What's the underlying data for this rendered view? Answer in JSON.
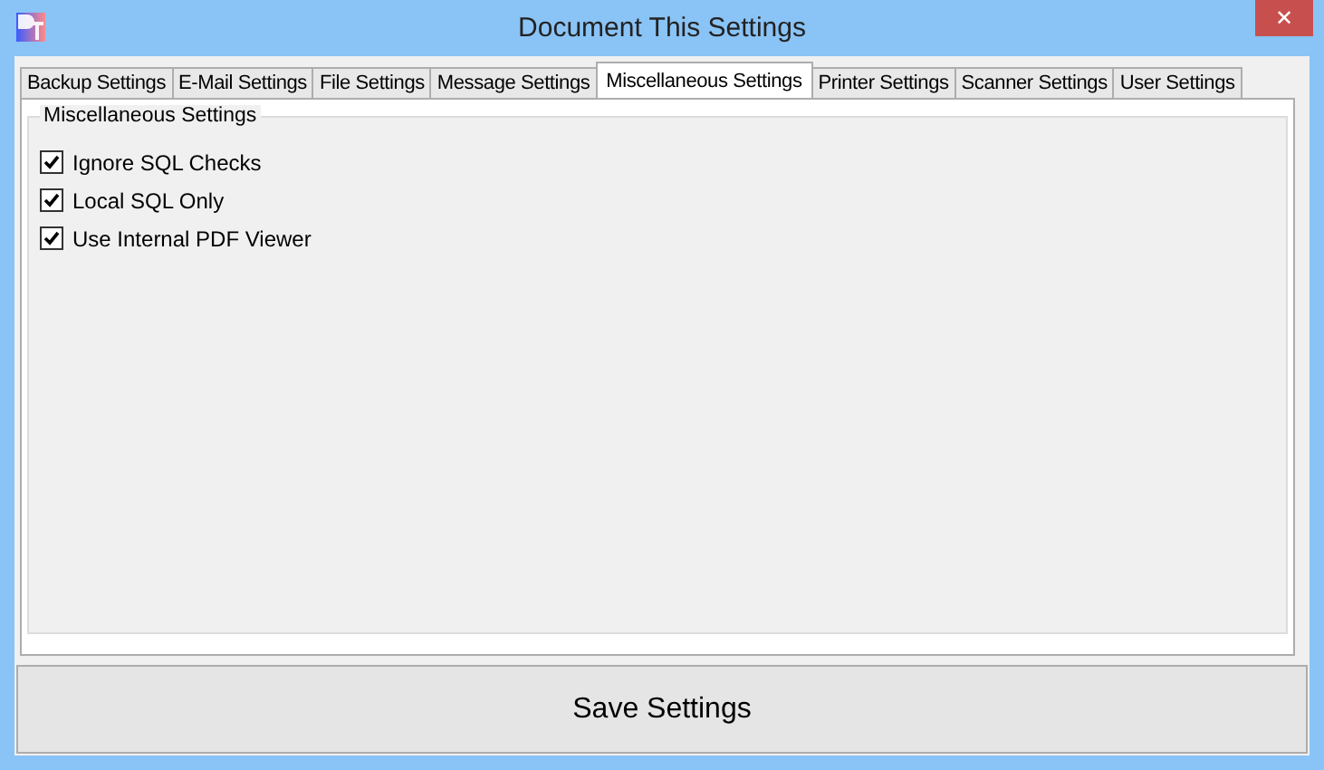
{
  "window": {
    "title": "Document This Settings",
    "close": "✕"
  },
  "tabs": [
    {
      "label": "Backup Settings",
      "selected": false
    },
    {
      "label": "E-Mail Settings",
      "selected": false
    },
    {
      "label": "File Settings",
      "selected": false
    },
    {
      "label": "Message Settings",
      "selected": false
    },
    {
      "label": "Miscellaneous Settings",
      "selected": true
    },
    {
      "label": "Printer Settings",
      "selected": false
    },
    {
      "label": "Scanner Settings",
      "selected": false
    },
    {
      "label": "User Settings",
      "selected": false
    }
  ],
  "group": {
    "title": "Miscellaneous Settings",
    "options": [
      {
        "label": "Ignore SQL Checks",
        "checked": true
      },
      {
        "label": "Local SQL Only",
        "checked": true
      },
      {
        "label": "Use Internal PDF Viewer",
        "checked": true
      }
    ]
  },
  "save_button": "Save Settings"
}
